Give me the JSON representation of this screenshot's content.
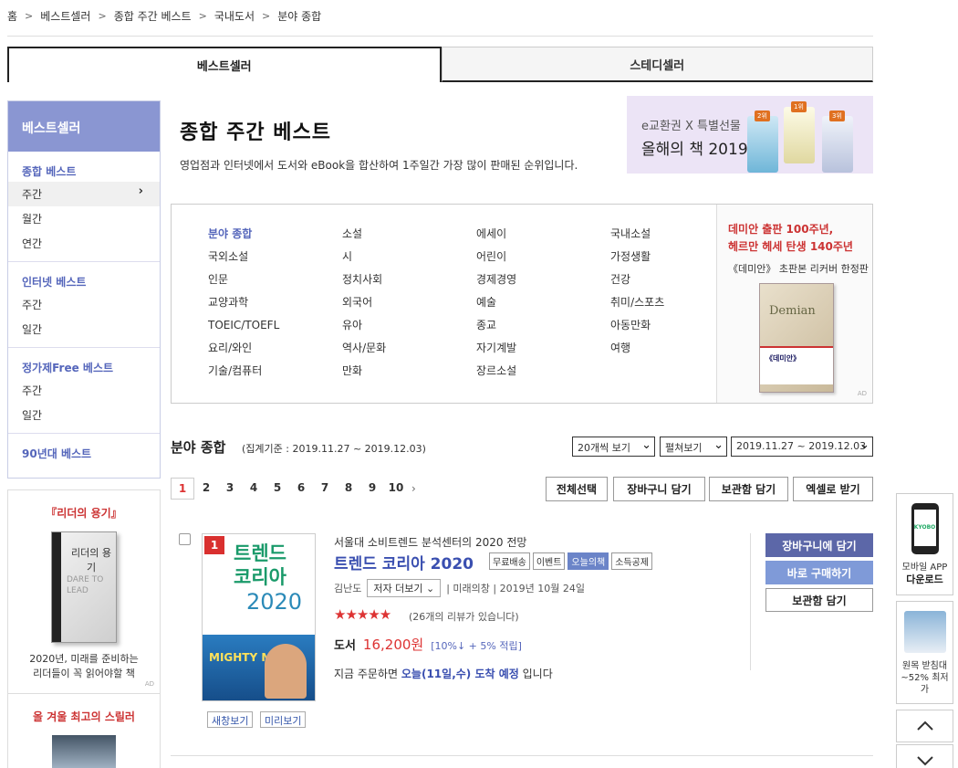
{
  "breadcrumb": [
    "홈",
    "베스트셀러",
    "종합 주간 베스트",
    "국내도서",
    "분야 종합"
  ],
  "main_tabs": [
    {
      "label": "베스트셀러",
      "active": true
    },
    {
      "label": "스테디셀러",
      "active": false
    }
  ],
  "sidebar": {
    "title": "베스트셀러",
    "groups": [
      {
        "title": "종합 베스트",
        "items": [
          "주간",
          "월간",
          "연간"
        ],
        "active_index": 0
      },
      {
        "title": "인터넷 베스트",
        "items": [
          "주간",
          "일간"
        ]
      },
      {
        "title": "정가제Free 베스트",
        "items": [
          "주간",
          "일간"
        ]
      },
      {
        "title": "90년대 베스트",
        "items": []
      }
    ]
  },
  "sidebar_ads": {
    "ad1": {
      "headline": "『리더의 용기』",
      "book_title": "리더의 용기",
      "book_sub": "DARE TO LEAD",
      "caption_line1": "2020년, 미래를 준비하는",
      "caption_line2": "리더들이 꼭 읽어야할 책",
      "mark": "AD"
    },
    "ad2": {
      "headline": "올 겨울 최고의 스릴러"
    }
  },
  "header": {
    "title": "종합 주간 베스트",
    "description": "영업점과 인터넷에서 도서와 eBook을 합산하여 1주일간 가장 많이 판매된 순위입니다."
  },
  "banner": {
    "line1": "e교환권 X 특별선물",
    "line2": "올해의 책 2019",
    "ranks": [
      "1위",
      "2위",
      "3위"
    ]
  },
  "categories": {
    "columns": [
      [
        "분야 종합",
        "국외소설",
        "인문",
        "교양과학",
        "TOEIC/TOEFL",
        "요리/와인",
        "기술/컴퓨터"
      ],
      [
        "소설",
        "시",
        "정치사회",
        "외국어",
        "유아",
        "역사/문화",
        "만화"
      ],
      [
        "에세이",
        "어린이",
        "경제경영",
        "예술",
        "종교",
        "자기계발",
        "장르소설"
      ],
      [
        "국내소설",
        "가정생활",
        "건강",
        "취미/스포츠",
        "아동만화",
        "여행"
      ]
    ],
    "active": "분야 종합"
  },
  "category_ad": {
    "line1": "데미안 출판 100주년,",
    "line2": "헤르만 헤세 탄생 140주년",
    "line3": "《데미안》 초판본 리커버 한정판",
    "book_title": "Demian",
    "band_text": "《데미안》",
    "mark": "AD"
  },
  "listing": {
    "title": "분야 종합",
    "period": "(집계기준 : 2019.11.27 ~ 2019.12.03)",
    "select_count": "20개씩 보기",
    "select_view": "펼쳐보기",
    "select_period": "2019.11.27 ~ 2019.12.03",
    "pages": [
      "1",
      "2",
      "3",
      "4",
      "5",
      "6",
      "7",
      "8",
      "9",
      "10"
    ],
    "current_page": "1",
    "actions": {
      "select_all": "전체선택",
      "cart": "장바구니 담기",
      "save": "보관함 담기",
      "excel": "엑셀로 받기"
    }
  },
  "product": {
    "rank": "1",
    "subtitle": "서울대 소비트렌드 분석센터의 2020 전망",
    "title": "트렌드 코리아 2020",
    "badges": [
      "무료배송",
      "이벤트",
      "오늘의책",
      "소득공제"
    ],
    "author": "김난도",
    "author_more": "저자 더보기",
    "publisher": "미래의창",
    "date": "2019년 10월 24일",
    "stars": "★★★★★",
    "review": "(26개의 리뷰가 있습니다)",
    "price_label": "도서",
    "price": "16,200원",
    "discount": "[10%↓ + 5% 적립]",
    "delivery_pre": "지금 주문하면",
    "delivery_hl": "오늘(11일,수) 도착 예정",
    "delivery_post": "입니다",
    "cover": {
      "title1": "트렌드",
      "title2": "코리아",
      "year": "2020",
      "band": "MIGHTY MICE"
    },
    "preview_new": "새창보기",
    "preview_look": "미리보기",
    "buttons": {
      "cart": "장바구니에 담기",
      "buy": "바로 구매하기",
      "save": "보관함 담기"
    }
  },
  "float": {
    "app_logo": "KYOBO",
    "app_line1": "모바일 APP",
    "app_line2": "다운로드",
    "ad_line1": "원목 받침대",
    "ad_line2": "~52% 최저가",
    "up_label": "︿",
    "down_label": "﹀"
  }
}
